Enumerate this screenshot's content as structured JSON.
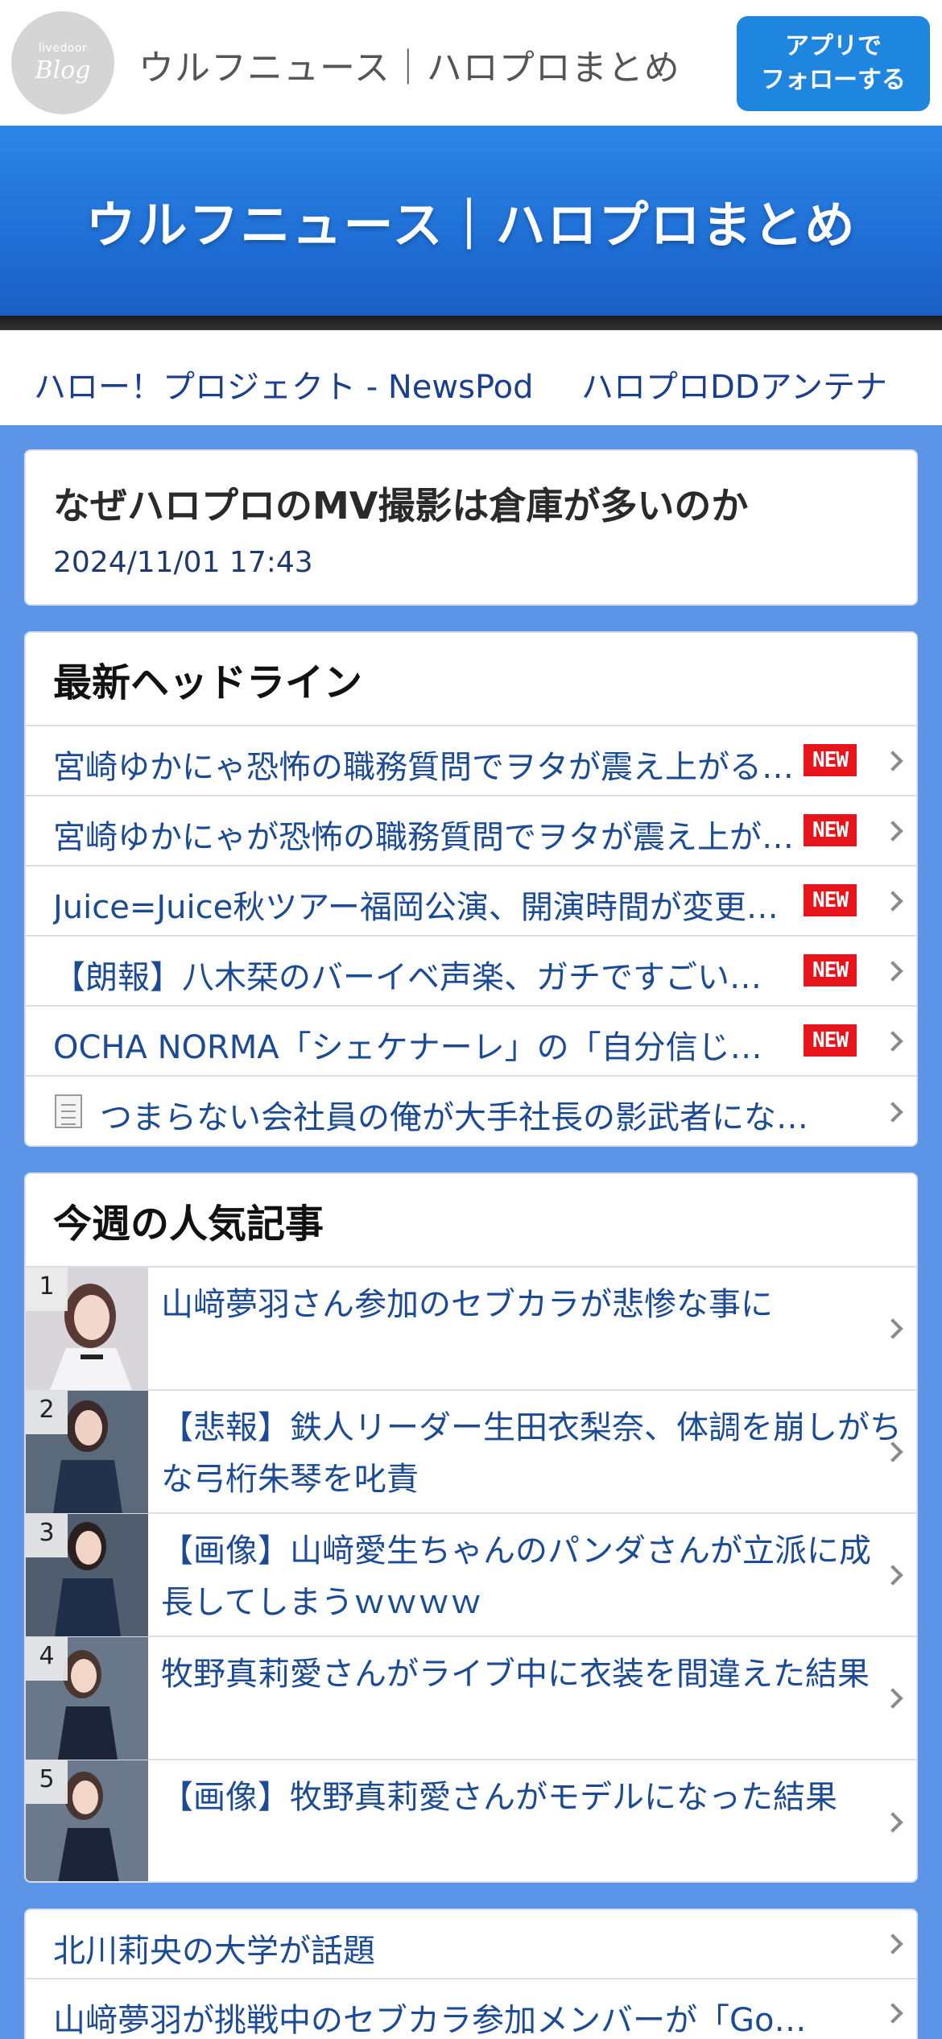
{
  "header": {
    "logo_small": "livedoor",
    "logo_big": "Blog",
    "site_title": "ウルフニュース｜ハロプロまとめ",
    "follow_line1": "アプリで",
    "follow_line2": "フォローする"
  },
  "banner": {
    "title": "ウルフニュース｜ハロプロまとめ"
  },
  "nav": {
    "links": [
      "ハロー！プロジェクト - NewsPod",
      "ハロプロDDアンテナ"
    ]
  },
  "article": {
    "title": "なぜハロプロのMV撮影は倉庫が多いのか",
    "date": "2024/11/01 17:43"
  },
  "headlines": {
    "heading": "最新ヘッドライン",
    "new_label": "NEW",
    "items": [
      "宮崎ゆかにゃ恐怖の職務質問でヲタが震え上がる…",
      "宮崎ゆかにゃが恐怖の職務質問でヲタが震え上がる…",
      "Juice=Juice秋ツアー福岡公演、開演時間が変更…",
      "【朗報】八木栞のバーイベ声楽、ガチですごい…",
      "OCHA NORMA「シェケナーレ」の「自分信じ…",
      "つまらない会社員の俺が大手社長の影武者にな…"
    ]
  },
  "popular": {
    "heading": "今週の人気記事",
    "items": [
      {
        "rank": "1",
        "title": "山﨑夢羽さん参加のセブカラが悲惨な事に"
      },
      {
        "rank": "2",
        "title": "【悲報】鉄人リーダー生田衣梨奈、体調を崩しがちな弓桁朱琴を叱責"
      },
      {
        "rank": "3",
        "title": "【画像】山﨑愛生ちゃんのパンダさんが立派に成長してしまうｗｗｗｗ"
      },
      {
        "rank": "4",
        "title": "牧野真莉愛さんがライブ中に衣装を間違えた結果"
      },
      {
        "rank": "5",
        "title": "【画像】牧野真莉愛さんがモデルになった結果"
      }
    ]
  },
  "more": {
    "items": [
      "北川莉央の大学が話題",
      "山﨑夢羽が挑戦中のセブカラ参加メンバーが「Go…"
    ]
  }
}
